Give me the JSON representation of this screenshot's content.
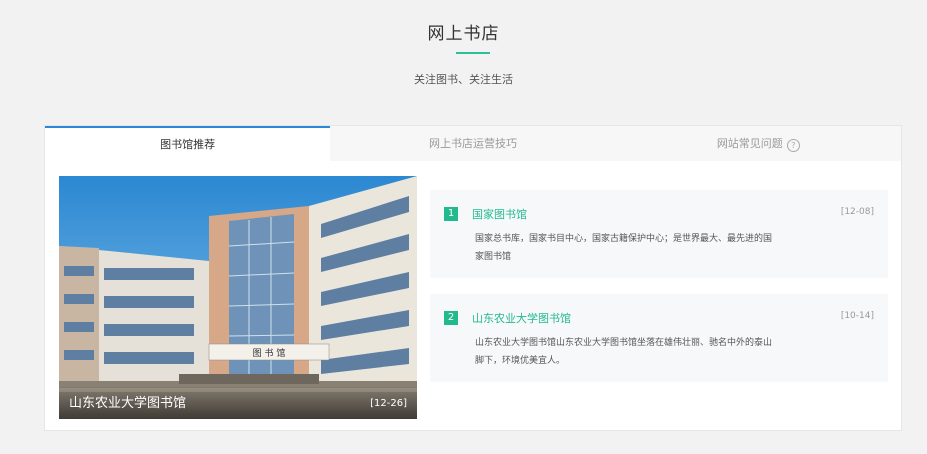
{
  "header": {
    "title": "网上书店",
    "subtitle": "关注图书、关注生活"
  },
  "tabs": [
    {
      "label": "图书馆推荐",
      "active": true
    },
    {
      "label": "网上书店运营技巧",
      "active": false
    },
    {
      "label": "网站常见问题",
      "active": false
    }
  ],
  "feature": {
    "title": "山东农业大学图书馆",
    "date": "[12-26]",
    "sign_text": "图 书 馆"
  },
  "news": [
    {
      "num": "1",
      "title": "国家图书馆",
      "date": "[12-08]",
      "desc": "国家总书库，国家书目中心，国家古籍保护中心；是世界最大、最先进的国家图书馆"
    },
    {
      "num": "2",
      "title": "山东农业大学图书馆",
      "date": "[10-14]",
      "desc": "山东农业大学图书馆山东农业大学图书馆坐落在雄伟壮丽、驰名中外的泰山脚下，环境优美宜人。"
    }
  ],
  "colors": {
    "accent": "#22b98e",
    "tab_active_border": "#2b88d8",
    "background": "#f2f2f2"
  },
  "icons": {
    "help": "question-circle-icon"
  }
}
